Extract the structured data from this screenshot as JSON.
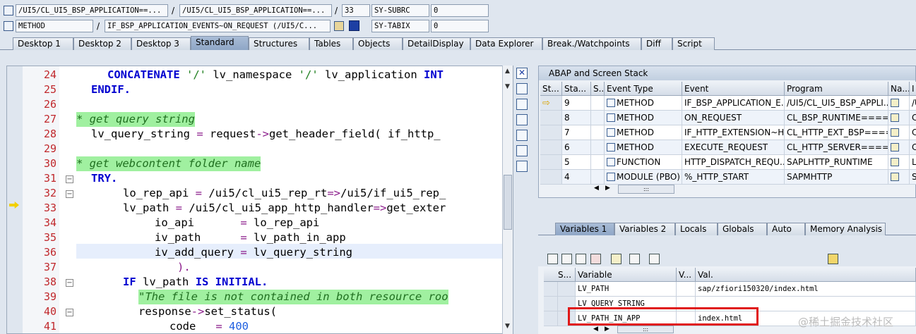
{
  "header": {
    "row1": {
      "program_field": "/UI5/CL_UI5_BSP_APPLICATION==...",
      "include_field": "/UI5/CL_UI5_BSP_APPLICATION==...",
      "line_field": "33",
      "sysvar1_name": "SY-SUBRC",
      "sysvar1_value": "0"
    },
    "row2": {
      "event_type_field": "METHOD",
      "event_field": "IF_BSP_APPLICATION_EVENTS~ON_REQUEST (/UI5/C...",
      "sysvar2_name": "SY-TABIX",
      "sysvar2_value": "0"
    },
    "separator": "/"
  },
  "desktop_tabs": [
    "Desktop 1",
    "Desktop 2",
    "Desktop 3",
    "Standard",
    "Structures",
    "Tables",
    "Objects",
    "DetailDisplay",
    "Data Explorer",
    "Break./Watchpoints",
    "Diff",
    "Script"
  ],
  "active_desktop_tab": "Standard",
  "code_lines": [
    {
      "no": "24"
    },
    {
      "no": "25"
    },
    {
      "no": "26"
    },
    {
      "no": "27"
    },
    {
      "no": "28"
    },
    {
      "no": "29"
    },
    {
      "no": "30"
    },
    {
      "no": "31"
    },
    {
      "no": "32"
    },
    {
      "no": "33"
    },
    {
      "no": "34"
    },
    {
      "no": "35"
    },
    {
      "no": "36"
    },
    {
      "no": "37"
    },
    {
      "no": "38"
    },
    {
      "no": "39"
    },
    {
      "no": "40"
    },
    {
      "no": "41"
    }
  ],
  "code_text": {
    "l24_kw": "CONCATENATE",
    "l24_s1": "'/'",
    "l24_mid": "lv_namespace",
    "l24_s2": "'/'",
    "l24_rest": "lv_application",
    "l24_kw2": "INT",
    "l25": "ENDIF.",
    "l27": "* get query string",
    "l28_a": "lv_query_string",
    "l28_op": "=",
    "l28_b": "request",
    "l28_arrow": "->",
    "l28_c": "get_header_field( if_http_",
    "l30": "* get webcontent folder name",
    "l31": "TRY.",
    "l32_a": "lo_rep_api",
    "l32_op": "=",
    "l32_b": "/ui5/cl_ui5_rep_rt",
    "l32_arrow": "=>",
    "l32_c": "/ui5/if_ui5_rep_",
    "l33_a": "lv_path",
    "l33_op": "=",
    "l33_b": "/ui5/cl_ui5_app_http_handler",
    "l33_arrow": "=>",
    "l33_c": "get_exter",
    "l34_a": "io_api      ",
    "l34_op": "=",
    "l34_b": "lo_rep_api",
    "l35_a": "iv_path     ",
    "l35_op": "=",
    "l35_b": "lv_path_in_app",
    "l36_a": "iv_add_query",
    "l36_op": "=",
    "l36_b": "lv_query_string",
    "l37": ").",
    "l38_kw": "IF",
    "l38_a": "lv_path",
    "l38_kw2": "IS INITIAL.",
    "l39": "\"The file is not contained in both resource roo",
    "l40_a": "response",
    "l40_arrow": "->",
    "l40_b": "set_status(",
    "l41_a": "code",
    "l41_op": "=",
    "l41_num": "400"
  },
  "stack": {
    "title": "ABAP and Screen Stack",
    "columns": [
      "St...",
      "Sta...",
      "S...",
      "Event Type",
      "Event",
      "Program",
      "Na...",
      "I"
    ],
    "rows": [
      {
        "level": "9",
        "type": "METHOD",
        "event": "IF_BSP_APPLICATION_E...",
        "program": "/UI5/CL_UI5_BSP_APPLI...",
        "last": "/U",
        "current": true
      },
      {
        "level": "8",
        "type": "METHOD",
        "event": "ON_REQUEST",
        "program": "CL_BSP_RUNTIME====...",
        "last": "CL",
        "current": false
      },
      {
        "level": "7",
        "type": "METHOD",
        "event": "IF_HTTP_EXTENSION~H...",
        "program": "CL_HTTP_EXT_BSP====...",
        "last": "CL",
        "current": false
      },
      {
        "level": "6",
        "type": "METHOD",
        "event": "EXECUTE_REQUEST",
        "program": "CL_HTTP_SERVER====...",
        "last": "CL",
        "current": false
      },
      {
        "level": "5",
        "type": "FUNCTION",
        "event": "HTTP_DISPATCH_REQU...",
        "program": "SAPLHTTP_RUNTIME",
        "last": "LH",
        "current": false
      },
      {
        "level": "4",
        "type": "MODULE (PBO)",
        "event": "%_HTTP_START",
        "program": "SAPMHTTP",
        "last": "SA",
        "current": false
      }
    ],
    "hscroll_grip": ":::"
  },
  "variable_tabs": [
    "Variables 1",
    "Variables 2",
    "Locals",
    "Globals",
    "Auto",
    "Memory Analysis"
  ],
  "active_variable_tab": "Variables 1",
  "variables": {
    "columns": [
      "S...",
      "Variable",
      "V...",
      "Val."
    ],
    "rows": [
      {
        "name": "LV_PATH",
        "value": "sap/zfiori150320/index.html"
      },
      {
        "name": "LV_QUERY_STRING",
        "value": ""
      },
      {
        "name": "LV_PATH_IN_APP",
        "value": "index.html"
      }
    ],
    "hscroll_grip": ":::"
  },
  "watermark": "@稀土掘金技术社区",
  "colors": {
    "highlight": "#e01818",
    "line_number": "#c0282c",
    "keyword": "#0000d0",
    "comment_bg": "#a0f0a0"
  }
}
